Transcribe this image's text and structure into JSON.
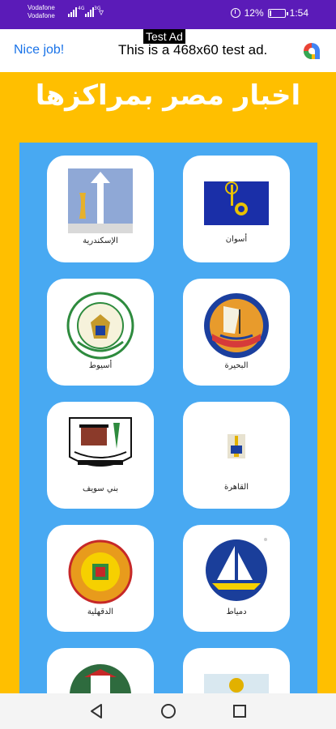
{
  "status_bar": {
    "carrier_1": "Vodafone",
    "carrier_2": "Vodafone",
    "net_1": "4G",
    "net_2": "3G",
    "battery_text": "12%",
    "battery_level": 0.12,
    "time": "1:54"
  },
  "ad": {
    "label": "Test Ad",
    "left_text": "Nice job!",
    "banner_text": "This is a 468x60 test ad."
  },
  "title": "اخبار مصر بمراكزها",
  "governorates": [
    {
      "name": "أسوان",
      "icon": "aswan-flag"
    },
    {
      "name": "الإسكندرية",
      "icon": "alexandria-emblem"
    },
    {
      "name": "البحيرة",
      "icon": "beheira-emblem"
    },
    {
      "name": "أسيوط",
      "icon": "asyut-emblem"
    },
    {
      "name": "القاهرة",
      "icon": "cairo-emblem"
    },
    {
      "name": "بني سويف",
      "icon": "beni-suef-emblem"
    },
    {
      "name": "دمياط",
      "icon": "damietta-emblem"
    },
    {
      "name": "الدقهلية",
      "icon": "dakahlia-emblem"
    },
    {
      "name": "",
      "icon": "next-row-emblem"
    },
    {
      "name": "",
      "icon": "next-row-emblem"
    }
  ],
  "nav": {
    "back": "back-icon",
    "home": "home-icon",
    "recents": "recents-icon"
  },
  "colors": {
    "status_bar": "#5B1BB8",
    "page_bg": "#FFBF00",
    "panel": "#48A9F2",
    "card": "#FFFFFF",
    "ad_link": "#1a73e8"
  }
}
